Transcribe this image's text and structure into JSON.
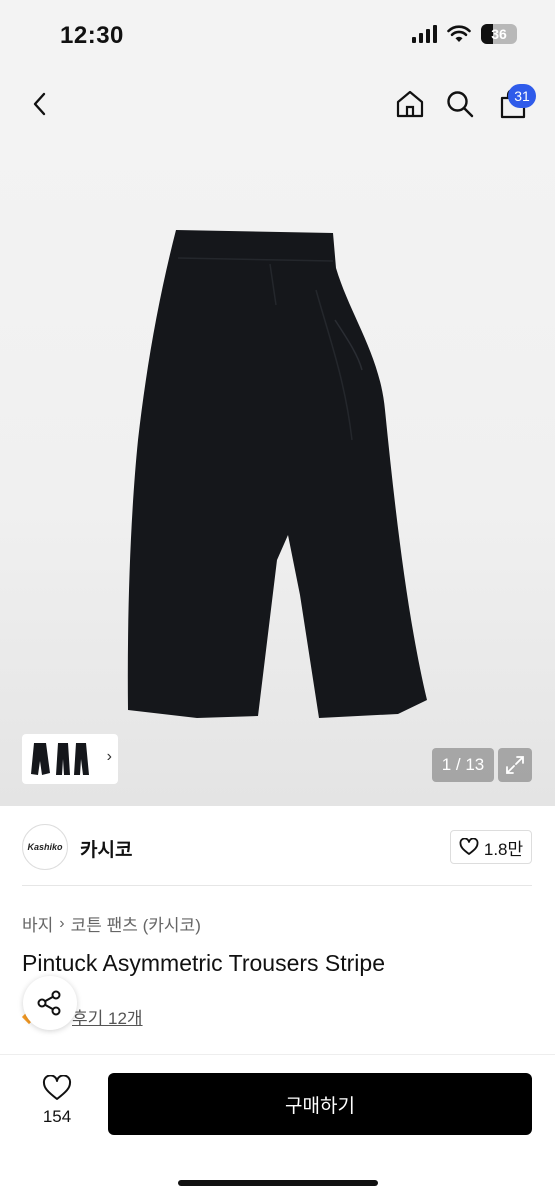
{
  "status_bar": {
    "time": "12:30",
    "battery": "36"
  },
  "nav": {
    "cart_badge": "31",
    "icons": [
      "chevron-left-icon",
      "home-icon",
      "search-icon",
      "shopping-bag-icon"
    ]
  },
  "gallery": {
    "counter": "1 / 13",
    "thumb_arrow": "›"
  },
  "brand": {
    "logo_text": "Kashiko",
    "name": "카시코",
    "likes": "1.8만"
  },
  "product": {
    "breadcrumb": [
      "바지",
      "코튼 팬츠 (카시코)"
    ],
    "title": "Pintuck Asymmetric Trousers Stripe",
    "review_link": "후기 12개"
  },
  "bottom_bar": {
    "wish_count": "154",
    "buy_label": "구매하기"
  },
  "colors": {
    "accent": "#2f5bea",
    "buy_button": "#000000",
    "rating_star": "#f59a23"
  }
}
